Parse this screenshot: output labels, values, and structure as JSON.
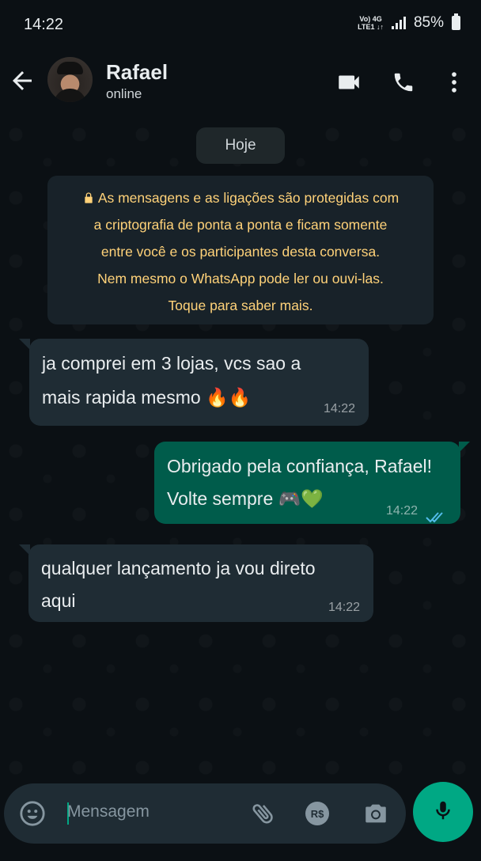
{
  "status": {
    "time": "14:22",
    "net_top": "Vo)  4G",
    "net_bottom": "LTE1 ↓↑",
    "battery": "85%"
  },
  "header": {
    "contact_name": "Rafael",
    "presence": "online",
    "icons": [
      "back-arrow-icon",
      "video-call-icon",
      "voice-call-icon",
      "more-vert-icon"
    ]
  },
  "chat": {
    "date_chip": "Hoje",
    "encryption_notice": {
      "line1": "As mensagens e as ligações são protegidas com",
      "line2": "a criptografia de ponta a ponta e ficam somente",
      "line3": "entre você e os participantes desta conversa.",
      "line4": "Nem mesmo o WhatsApp pode ler ou ouvi-las.",
      "line5": "Toque para saber mais."
    },
    "messages": [
      {
        "direction": "in",
        "line1": "ja comprei em 3 lojas, vcs sao a",
        "line2": "mais rapida mesmo 🔥🔥",
        "time": "14:22"
      },
      {
        "direction": "out",
        "line1": "Obrigado pela confiança, Rafael!",
        "line2": "Volte sempre 🎮💚",
        "time": "14:22",
        "status": "read"
      },
      {
        "direction": "in",
        "line1": "qualquer lançamento ja vou direto",
        "line2": "aqui",
        "time": "14:22"
      }
    ]
  },
  "composer": {
    "placeholder": "Mensagem",
    "payment_label": "R$",
    "icons": [
      "emoji-icon",
      "attach-icon",
      "payment-icon",
      "camera-icon",
      "mic-icon"
    ]
  },
  "colors": {
    "accent": "#00a884",
    "outgoing_bubble": "#005c4b",
    "incoming_bubble": "#1f2c34",
    "notice_text": "#ffd279",
    "read_ticks": "#53bdeb"
  }
}
